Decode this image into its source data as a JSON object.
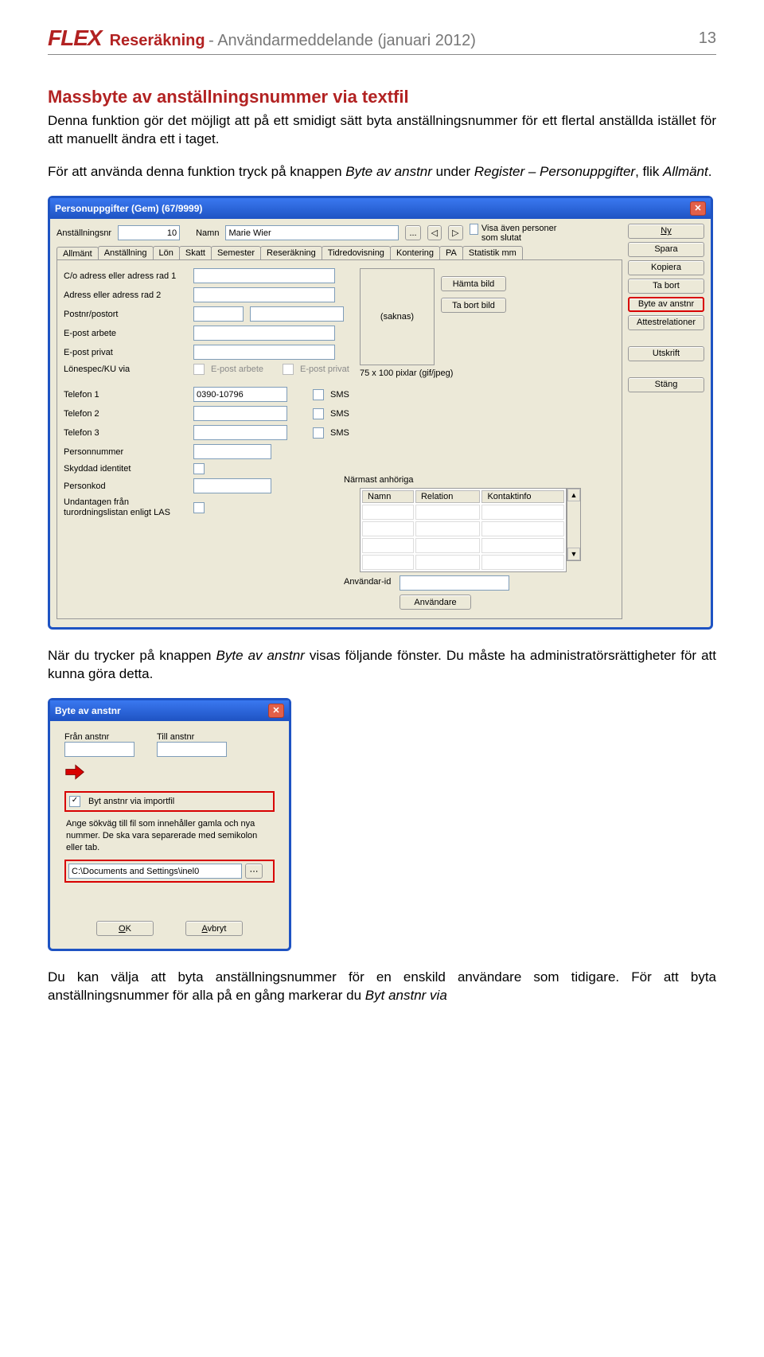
{
  "header": {
    "logo": "FLEX",
    "title": "Reseräkning",
    "subtitle": " - Användarmeddelande (januari 2012)",
    "page": "13"
  },
  "doc": {
    "h1": "Massbyte av anställningsnummer via textfil",
    "p1": "Denna funktion gör det möjligt att på ett smidigt sätt byta anställningsnummer för ett flertal anställda istället för att manuellt ändra ett i taget.",
    "p2_a": "För att använda denna funktion tryck på knappen ",
    "p2_b": "Byte av anstnr",
    "p2_c": " under ",
    "p2_d": "Register – Personuppgifter",
    "p2_e": ", flik ",
    "p2_f": "Allmänt",
    "p2_g": ".",
    "p3_a": "När du trycker på knappen ",
    "p3_b": "Byte av anstnr",
    "p3_c": " visas följande fönster. Du måste ha administratörsrättigheter för att kunna göra detta.",
    "p4_a": "Du kan välja att byta anställningsnummer för en enskild användare som tidigare. För att byta anställningsnummer för alla på en gång markerar du ",
    "p4_b": "Byt anstnr via"
  },
  "pu": {
    "title": "Personuppgifter (Gem) (67/9999)",
    "anst_lbl": "Anställningsnr",
    "anst_val": "10",
    "namn_lbl": "Namn",
    "namn_val": "Marie Wier",
    "dots": "...",
    "prev": "◁",
    "next": "▷",
    "slutat_lbl": "Visa även personer som slutat",
    "tabs": [
      "Allmänt",
      "Anställning",
      "Lön",
      "Skatt",
      "Semester",
      "Reseräkning",
      "Tidredovisning",
      "Kontering",
      "PA",
      "Statistik mm"
    ],
    "fields": {
      "co": "C/o adress eller adress rad 1",
      "adr2": "Adress eller adress rad 2",
      "postnr": "Postnr/postort",
      "ep_arb": "E-post arbete",
      "ep_priv": "E-post privat",
      "lonespec": "Lönespec/KU via",
      "lonespec_chk1": "E-post arbete",
      "lonespec_chk2": "E-post privat",
      "tel1": "Telefon 1",
      "tel1_val": "0390-10796",
      "tel2": "Telefon 2",
      "tel3": "Telefon 3",
      "sms": "SMS",
      "persnr": "Personnummer",
      "skyddad": "Skyddad identitet",
      "personkod": "Personkod",
      "undantag": "Undantagen från turordningslistan enligt LAS"
    },
    "photo": {
      "saknas": "(saknas)",
      "hamta": "Hämta bild",
      "tabort": "Ta bort bild",
      "caption": "75 x 100 pixlar (gif/jpeg)"
    },
    "kin": {
      "label": "Närmast anhöriga",
      "h1": "Namn",
      "h2": "Relation",
      "h3": "Kontaktinfo"
    },
    "user": {
      "lbl": "Användar-id",
      "btn": "Användare"
    },
    "buttons": {
      "ny": "Ny",
      "spara": "Spara",
      "kopiera": "Kopiera",
      "tabort": "Ta bort",
      "byte": "Byte av anstnr",
      "attest": "Attestrelationer",
      "utskrift": "Utskrift",
      "stang": "Stäng"
    }
  },
  "ba": {
    "title": "Byte av anstnr",
    "from": "Från anstnr",
    "to": "Till anstnr",
    "chk": "Byt anstnr via importfil",
    "info": "Ange sökväg till fil som innehåller gamla och nya nummer. De ska vara separerade med semikolon eller tab.",
    "file": "C:\\Documents and Settings\\inel0",
    "browse": "⋯",
    "ok_u": "O",
    "ok_rest": "K",
    "cancel_u": "A",
    "cancel_rest": "vbryt"
  }
}
